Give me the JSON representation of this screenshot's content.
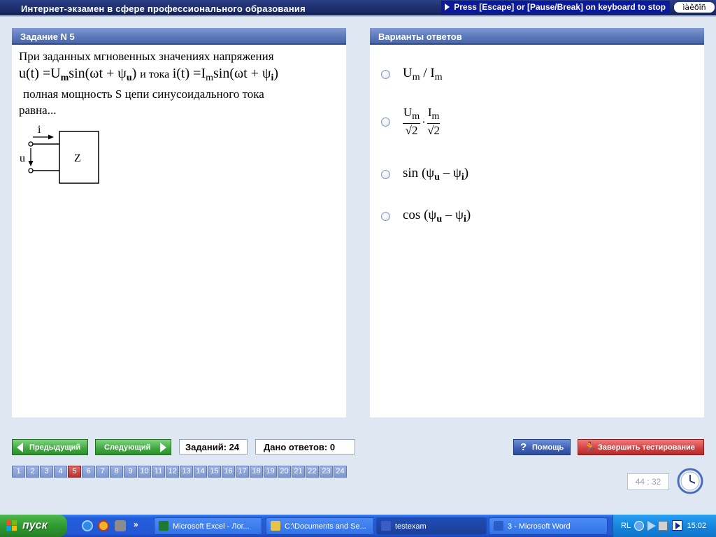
{
  "app": {
    "title": "Интернет-экзамен в сфере профессионального образования",
    "escape_hint": "Press [Escape] or [Pause/Break] on keyboard to stop",
    "keyboard_indicator": "ìàêðîñ"
  },
  "task": {
    "header": "Задание N 5",
    "text_line1": "При заданных мгновенных значениях напряжения",
    "connector_text": "и тока",
    "text_line3": "полная мощность S цепи синусоидального тока",
    "text_line4": "равна...",
    "formula_u": {
      "lhs": "u(t) =",
      "amp": "U",
      "amp_sub": "m",
      "body": "sin(ωt + ψ",
      "phase_sub": "u",
      "close": ")"
    },
    "formula_i": {
      "lhs": "i(t) =",
      "amp": "I",
      "amp_sub": "m",
      "body": "sin(ωt + ψ",
      "phase_sub": "i",
      "close": ")"
    },
    "diagram": {
      "current_label": "i",
      "voltage_label": "u",
      "impedance_label": "Z"
    }
  },
  "answers": {
    "header": "Варианты ответов",
    "options": [
      {
        "a": "U",
        "a_sub": "m",
        "sep": " / ",
        "b": "I",
        "b_sub": "m"
      },
      {
        "num1": "U",
        "num1_sub": "m",
        "den1": "√2",
        "dot": "·",
        "num2": "I",
        "num2_sub": "m",
        "den2": "√2"
      },
      {
        "fn": "sin",
        "open": " (ψ",
        "sub1": "u",
        "minus": " – ψ",
        "sub2": "i",
        "close": ")"
      },
      {
        "fn": "cos",
        "open": " (ψ",
        "sub1": "u",
        "minus": " – ψ",
        "sub2": "i",
        "close": ")"
      }
    ]
  },
  "controls": {
    "prev": "Предыдущий",
    "next": "Следующий",
    "tasks_count": "Заданий: 24",
    "answered": "Дано ответов: 0",
    "help": "Помощь",
    "finish": "Завершить тестирование",
    "current_question": 5,
    "question_numbers": [
      "1",
      "2",
      "3",
      "4",
      "5",
      "6",
      "7",
      "8",
      "9",
      "10",
      "11",
      "12",
      "13",
      "14",
      "15",
      "16",
      "17",
      "18",
      "19",
      "20",
      "21",
      "22",
      "23",
      "24"
    ],
    "timer": "44 : 32"
  },
  "taskbar": {
    "start": "пуск",
    "buttons": [
      {
        "label": "Microsoft Excel - Лог...",
        "icon_color": "#1d7a2e",
        "icon": "excel-icon"
      },
      {
        "label": "C:\\Documents and Se...",
        "icon_color": "#e8c34a",
        "icon": "folder-icon"
      },
      {
        "label": "testexam",
        "icon_color": "#3b5cc7",
        "icon": "testexam-icon"
      },
      {
        "label": "3 - Microsoft Word",
        "icon_color": "#2b5bc7",
        "icon": "word-icon"
      }
    ],
    "lang": "RL",
    "time": "15:02"
  }
}
